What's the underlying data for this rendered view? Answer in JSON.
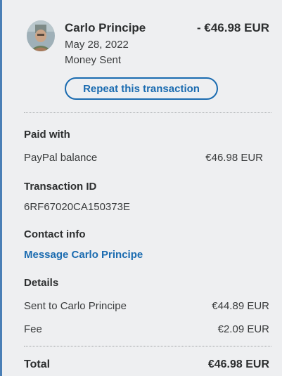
{
  "header": {
    "name": "Carlo Principe",
    "amount": "- €46.98 EUR",
    "date": "May 28, 2022",
    "status": "Money Sent",
    "repeat_label": "Repeat this transaction"
  },
  "paid_with": {
    "label": "Paid with",
    "method": "PayPal balance",
    "amount": "€46.98 EUR"
  },
  "transaction": {
    "label": "Transaction ID",
    "id": "6RF67020CA150373E"
  },
  "contact": {
    "label": "Contact info",
    "link": "Message Carlo Principe"
  },
  "details": {
    "label": "Details",
    "rows": [
      {
        "label": "Sent to Carlo Principe",
        "value": "€44.89 EUR"
      },
      {
        "label": "Fee",
        "value": "€2.09 EUR"
      }
    ]
  },
  "total": {
    "label": "Total",
    "value": "€46.98 EUR"
  },
  "colors": {
    "accent": "#1a6bb0",
    "text": "#2c2e2f",
    "background": "#eeeff1"
  },
  "icons": {
    "avatar": "profile-photo"
  }
}
